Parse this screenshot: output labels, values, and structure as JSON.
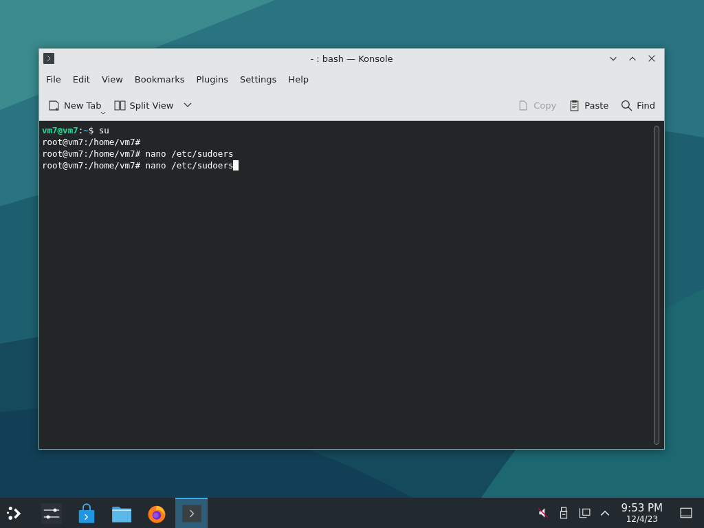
{
  "window": {
    "title": "- : bash — Konsole"
  },
  "menu": [
    "File",
    "Edit",
    "View",
    "Bookmarks",
    "Plugins",
    "Settings",
    "Help"
  ],
  "toolbar_left": [
    {
      "label": "New Tab",
      "kind": "newtab",
      "disabled": false
    },
    {
      "label": "Split View",
      "kind": "split",
      "disabled": false
    }
  ],
  "toolbar_right": [
    {
      "label": "Copy",
      "kind": "copy",
      "disabled": true
    },
    {
      "label": "Paste",
      "kind": "paste",
      "disabled": false
    },
    {
      "label": "Find",
      "kind": "find",
      "disabled": false
    }
  ],
  "terminal": {
    "lines": [
      [
        {
          "text": "vm7@vm7",
          "kind": "user"
        },
        {
          "text": ":",
          "kind": "plain"
        },
        {
          "text": "~",
          "kind": "path"
        },
        {
          "text": "$ su",
          "kind": "plain"
        }
      ],
      [
        {
          "text": "root@vm7:/home/vm7#",
          "kind": "plain"
        }
      ],
      [
        {
          "text": "root@vm7:/home/vm7# nano /etc/sudoers",
          "kind": "plain"
        }
      ],
      [
        {
          "text": "root@vm7:/home/vm7# nano /etc/sudoers",
          "kind": "plain"
        }
      ]
    ],
    "cursor": true
  },
  "taskbar": {
    "tasks": [
      {
        "kind": "launcher",
        "selected": false
      },
      {
        "kind": "settings",
        "selected": false
      },
      {
        "kind": "store",
        "selected": false
      },
      {
        "kind": "files",
        "selected": false
      },
      {
        "kind": "browser",
        "selected": false
      },
      {
        "kind": "terminal",
        "selected": true
      }
    ],
    "tray": [
      {
        "kind": "muted"
      },
      {
        "kind": "usb"
      },
      {
        "kind": "network"
      },
      {
        "kind": "expand"
      }
    ],
    "clock": {
      "time": "9:53 PM",
      "date": "12/4/23"
    }
  }
}
